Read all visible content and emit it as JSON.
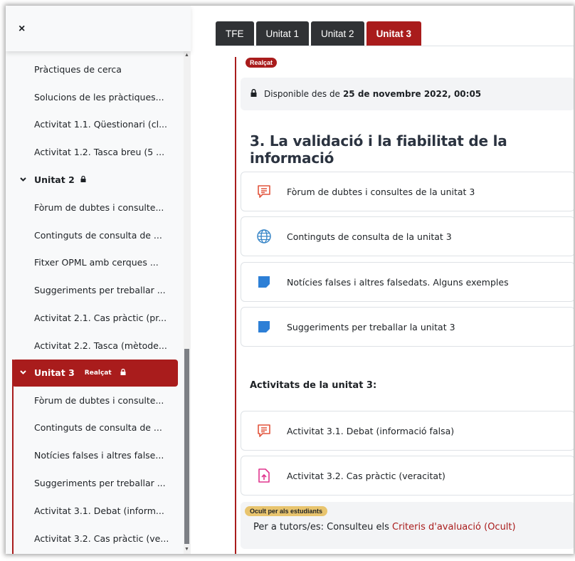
{
  "sidebar": {
    "close_label": "×",
    "items_top": [
      "Pràctiques de cerca",
      "Solucions de les pràctiques...",
      "Activitat 1.1. Qüestionari (cl...",
      "Activitat 1.2. Tasca breu (5 ..."
    ],
    "section2": {
      "label": "Unitat 2",
      "icon": "lock-icon"
    },
    "items_unit2": [
      "Fòrum de dubtes i consulte...",
      "Continguts de consulta de ...",
      "Fitxer OPML amb cerques ...",
      "Suggeriments per treballar ...",
      "Activitat 2.1. Cas pràctic (pr...",
      "Activitat 2.2. Tasca (mètode..."
    ],
    "section3": {
      "label": "Unitat 3",
      "badge": "Realçat",
      "icon": "lock-icon"
    },
    "items_unit3": [
      "Fòrum de dubtes i consulte...",
      "Continguts de consulta de ...",
      "Notícies falses i altres false...",
      "Suggeriments per treballar ...",
      "Activitat 3.1. Debat (inform...",
      "Activitat 3.2. Cas pràctic (ve..."
    ]
  },
  "tabs": [
    "TFE",
    "Unitat 1",
    "Unitat 2",
    "Unitat 3"
  ],
  "active_tab": "Unitat 3",
  "main": {
    "highlight_badge": "Realçat",
    "availability_prefix": "Disponible des de",
    "availability_date": "25 de novembre 2022, 00:05",
    "section_title": "3. La validació i la fiabilitat de la informació",
    "activities": [
      {
        "label": "Fòrum de dubtes i consultes de la unitat 3",
        "icon": "forum-icon"
      },
      {
        "label": "Continguts de consulta de la unitat 3",
        "icon": "globe-icon"
      },
      {
        "label": "Notícies falses i altres falsedats. Alguns exemples",
        "icon": "page-icon"
      },
      {
        "label": "Suggeriments per treballar la unitat 3",
        "icon": "page-icon"
      }
    ],
    "activities_heading": "Activitats de la unitat 3:",
    "activities2": [
      {
        "label": "Activitat 3.1. Debat (informació falsa)",
        "icon": "forum-icon"
      },
      {
        "label": "Activitat 3.2. Cas pràctic (veracitat)",
        "icon": "assignment-icon"
      }
    ],
    "hidden_badge": "Ocult per als estudiants",
    "hidden_text_prefix": "Per a tutors/es: Consulteu els",
    "hidden_link": "Criteris d'avaluació (Ocult)"
  },
  "colors": {
    "accent": "#a91c1c",
    "dark_tab": "#303235",
    "badge_hidden": "#e8c46e"
  }
}
